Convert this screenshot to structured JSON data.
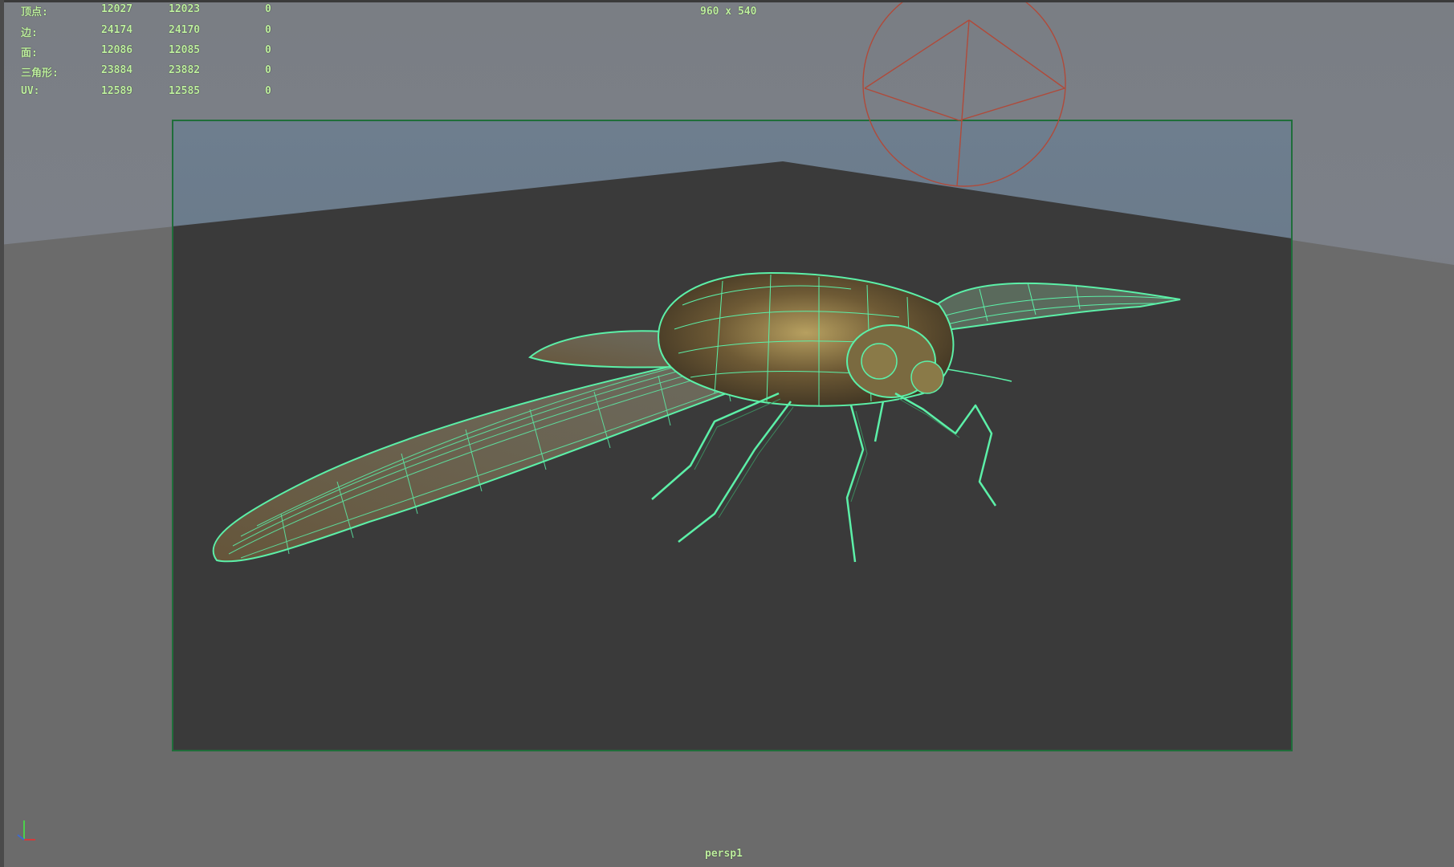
{
  "viewport": {
    "resolution_label": "960 x 540",
    "camera_label": "persp1",
    "axis_indicator": [
      "z",
      "y",
      "x"
    ]
  },
  "poly_stats": [
    {
      "label": "顶点:",
      "v1": "12027",
      "v2": "12023",
      "v3": "0"
    },
    {
      "label": "边:",
      "v1": "24174",
      "v2": "24170",
      "v3": "0"
    },
    {
      "label": "面:",
      "v1": "12086",
      "v2": "12085",
      "v3": "0"
    },
    {
      "label": "三角形:",
      "v1": "23884",
      "v2": "23882",
      "v3": "0"
    },
    {
      "label": "UV:",
      "v1": "12589",
      "v2": "12585",
      "v3": "0"
    }
  ],
  "colors": {
    "hud_text": "#bff0a0",
    "wireframe": "#5cf0a8",
    "gate_border": "#1f6e3a",
    "camera_gizmo": "#b04a3a"
  }
}
